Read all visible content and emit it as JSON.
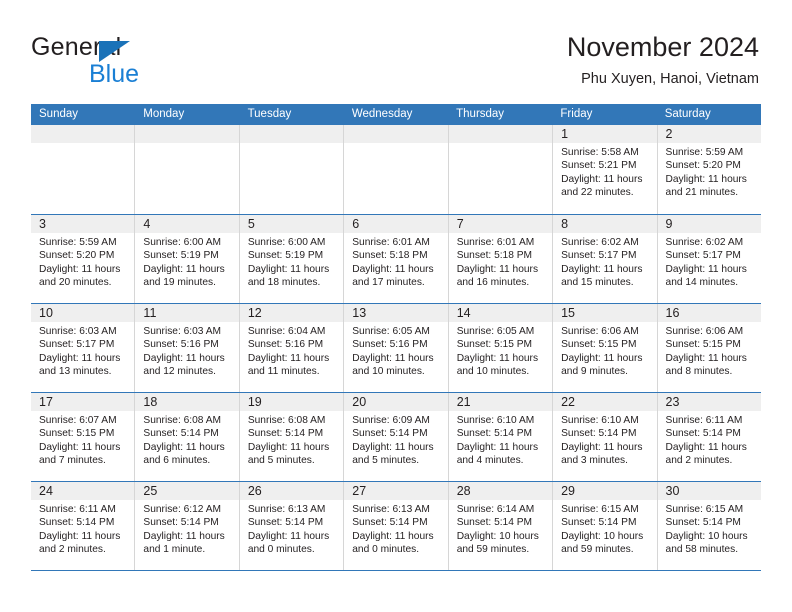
{
  "brand": {
    "word1": "General",
    "word2": "Blue",
    "accent_color": "#1a7fd4",
    "triangle_color": "#1a72b8"
  },
  "header": {
    "title": "November 2024",
    "location": "Phu Xuyen, Hanoi, Vietnam"
  },
  "theme": {
    "header_blue": "#3277b8",
    "day_band_gray": "#efefef",
    "grid_line": "#d6d6d6"
  },
  "weekdays": [
    "Sunday",
    "Monday",
    "Tuesday",
    "Wednesday",
    "Thursday",
    "Friday",
    "Saturday"
  ],
  "weeks": [
    [
      {
        "date": "",
        "empty": true
      },
      {
        "date": "",
        "empty": true
      },
      {
        "date": "",
        "empty": true
      },
      {
        "date": "",
        "empty": true
      },
      {
        "date": "",
        "empty": true
      },
      {
        "date": "1",
        "sunrise": "Sunrise: 5:58 AM",
        "sunset": "Sunset: 5:21 PM",
        "daylight": "Daylight: 11 hours and 22 minutes."
      },
      {
        "date": "2",
        "sunrise": "Sunrise: 5:59 AM",
        "sunset": "Sunset: 5:20 PM",
        "daylight": "Daylight: 11 hours and 21 minutes."
      }
    ],
    [
      {
        "date": "3",
        "sunrise": "Sunrise: 5:59 AM",
        "sunset": "Sunset: 5:20 PM",
        "daylight": "Daylight: 11 hours and 20 minutes."
      },
      {
        "date": "4",
        "sunrise": "Sunrise: 6:00 AM",
        "sunset": "Sunset: 5:19 PM",
        "daylight": "Daylight: 11 hours and 19 minutes."
      },
      {
        "date": "5",
        "sunrise": "Sunrise: 6:00 AM",
        "sunset": "Sunset: 5:19 PM",
        "daylight": "Daylight: 11 hours and 18 minutes."
      },
      {
        "date": "6",
        "sunrise": "Sunrise: 6:01 AM",
        "sunset": "Sunset: 5:18 PM",
        "daylight": "Daylight: 11 hours and 17 minutes."
      },
      {
        "date": "7",
        "sunrise": "Sunrise: 6:01 AM",
        "sunset": "Sunset: 5:18 PM",
        "daylight": "Daylight: 11 hours and 16 minutes."
      },
      {
        "date": "8",
        "sunrise": "Sunrise: 6:02 AM",
        "sunset": "Sunset: 5:17 PM",
        "daylight": "Daylight: 11 hours and 15 minutes."
      },
      {
        "date": "9",
        "sunrise": "Sunrise: 6:02 AM",
        "sunset": "Sunset: 5:17 PM",
        "daylight": "Daylight: 11 hours and 14 minutes."
      }
    ],
    [
      {
        "date": "10",
        "sunrise": "Sunrise: 6:03 AM",
        "sunset": "Sunset: 5:17 PM",
        "daylight": "Daylight: 11 hours and 13 minutes."
      },
      {
        "date": "11",
        "sunrise": "Sunrise: 6:03 AM",
        "sunset": "Sunset: 5:16 PM",
        "daylight": "Daylight: 11 hours and 12 minutes."
      },
      {
        "date": "12",
        "sunrise": "Sunrise: 6:04 AM",
        "sunset": "Sunset: 5:16 PM",
        "daylight": "Daylight: 11 hours and 11 minutes."
      },
      {
        "date": "13",
        "sunrise": "Sunrise: 6:05 AM",
        "sunset": "Sunset: 5:16 PM",
        "daylight": "Daylight: 11 hours and 10 minutes."
      },
      {
        "date": "14",
        "sunrise": "Sunrise: 6:05 AM",
        "sunset": "Sunset: 5:15 PM",
        "daylight": "Daylight: 11 hours and 10 minutes."
      },
      {
        "date": "15",
        "sunrise": "Sunrise: 6:06 AM",
        "sunset": "Sunset: 5:15 PM",
        "daylight": "Daylight: 11 hours and 9 minutes."
      },
      {
        "date": "16",
        "sunrise": "Sunrise: 6:06 AM",
        "sunset": "Sunset: 5:15 PM",
        "daylight": "Daylight: 11 hours and 8 minutes."
      }
    ],
    [
      {
        "date": "17",
        "sunrise": "Sunrise: 6:07 AM",
        "sunset": "Sunset: 5:15 PM",
        "daylight": "Daylight: 11 hours and 7 minutes."
      },
      {
        "date": "18",
        "sunrise": "Sunrise: 6:08 AM",
        "sunset": "Sunset: 5:14 PM",
        "daylight": "Daylight: 11 hours and 6 minutes."
      },
      {
        "date": "19",
        "sunrise": "Sunrise: 6:08 AM",
        "sunset": "Sunset: 5:14 PM",
        "daylight": "Daylight: 11 hours and 5 minutes."
      },
      {
        "date": "20",
        "sunrise": "Sunrise: 6:09 AM",
        "sunset": "Sunset: 5:14 PM",
        "daylight": "Daylight: 11 hours and 5 minutes."
      },
      {
        "date": "21",
        "sunrise": "Sunrise: 6:10 AM",
        "sunset": "Sunset: 5:14 PM",
        "daylight": "Daylight: 11 hours and 4 minutes."
      },
      {
        "date": "22",
        "sunrise": "Sunrise: 6:10 AM",
        "sunset": "Sunset: 5:14 PM",
        "daylight": "Daylight: 11 hours and 3 minutes."
      },
      {
        "date": "23",
        "sunrise": "Sunrise: 6:11 AM",
        "sunset": "Sunset: 5:14 PM",
        "daylight": "Daylight: 11 hours and 2 minutes."
      }
    ],
    [
      {
        "date": "24",
        "sunrise": "Sunrise: 6:11 AM",
        "sunset": "Sunset: 5:14 PM",
        "daylight": "Daylight: 11 hours and 2 minutes."
      },
      {
        "date": "25",
        "sunrise": "Sunrise: 6:12 AM",
        "sunset": "Sunset: 5:14 PM",
        "daylight": "Daylight: 11 hours and 1 minute."
      },
      {
        "date": "26",
        "sunrise": "Sunrise: 6:13 AM",
        "sunset": "Sunset: 5:14 PM",
        "daylight": "Daylight: 11 hours and 0 minutes."
      },
      {
        "date": "27",
        "sunrise": "Sunrise: 6:13 AM",
        "sunset": "Sunset: 5:14 PM",
        "daylight": "Daylight: 11 hours and 0 minutes."
      },
      {
        "date": "28",
        "sunrise": "Sunrise: 6:14 AM",
        "sunset": "Sunset: 5:14 PM",
        "daylight": "Daylight: 10 hours and 59 minutes."
      },
      {
        "date": "29",
        "sunrise": "Sunrise: 6:15 AM",
        "sunset": "Sunset: 5:14 PM",
        "daylight": "Daylight: 10 hours and 59 minutes."
      },
      {
        "date": "30",
        "sunrise": "Sunrise: 6:15 AM",
        "sunset": "Sunset: 5:14 PM",
        "daylight": "Daylight: 10 hours and 58 minutes."
      }
    ]
  ]
}
